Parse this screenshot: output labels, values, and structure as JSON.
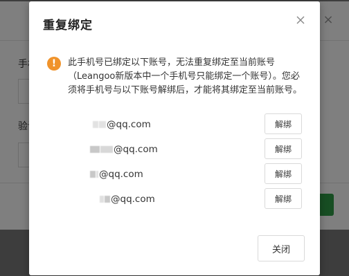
{
  "background": {
    "phone_label": "手机",
    "code_label": "验证",
    "close_symbol": "×"
  },
  "modal": {
    "title": "重复绑定",
    "close_symbol": "×",
    "warning_icon_symbol": "!",
    "message": "此手机号已绑定以下账号，无法重复绑定至当前账号（Leangoo新版本中一个手机号只能绑定一个账号）。您必须将手机号与以下账号解绑后，才能将其绑定至当前账号。",
    "accounts": [
      {
        "email": "@qq.com",
        "unbind_label": "解绑"
      },
      {
        "email": "@qq.com",
        "unbind_label": "解绑"
      },
      {
        "email": "@qq.com",
        "unbind_label": "解绑"
      },
      {
        "email": "@qq.com",
        "unbind_label": "解绑"
      }
    ],
    "close_label": "关闭"
  },
  "colors": {
    "warning": "#f0932b",
    "primary_green": "#2e9c47"
  }
}
